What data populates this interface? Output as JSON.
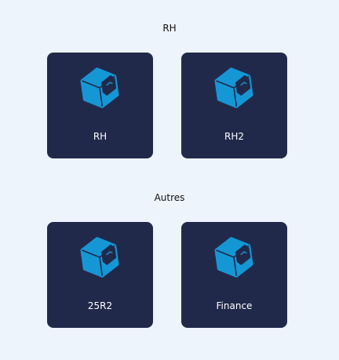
{
  "sections": [
    {
      "title": "RH",
      "tiles": [
        {
          "label": "RH",
          "icon": "cube-icon"
        },
        {
          "label": "RH2",
          "icon": "cube-icon"
        }
      ]
    },
    {
      "title": "Autres",
      "tiles": [
        {
          "label": "25R2",
          "icon": "cube-icon"
        },
        {
          "label": "Finance",
          "icon": "cube-icon"
        }
      ]
    }
  ],
  "colors": {
    "page_background": "#eef4fc",
    "tile_background": "#21294b",
    "icon_primary": "#1597d5",
    "icon_dark": "#21294b"
  }
}
